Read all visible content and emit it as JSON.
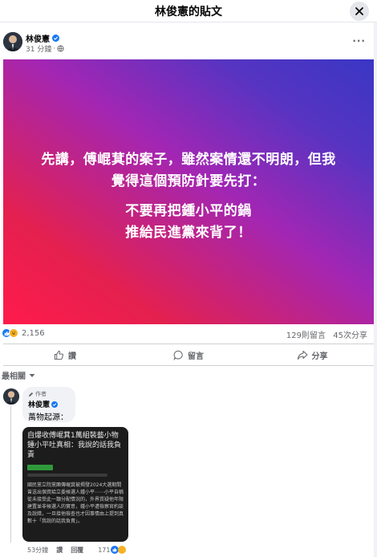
{
  "dialog": {
    "title": "林俊憲的貼文"
  },
  "post": {
    "author": "林俊憲",
    "time": "31 分鐘",
    "image_lines": [
      "先講，傅崐萁的案子，雖然案情還不明朗，但我",
      "覺得這個預防針要先打：",
      "不要再把鍾小平的鍋",
      "推給民進黨來背了！"
    ],
    "image_colors": {
      "start": "#ff1b4b",
      "end": "#3a36c4"
    }
  },
  "stats": {
    "reactions": "2,156",
    "comments": "129則留言",
    "shares": "45次分享"
  },
  "actions": {
    "like": "讚",
    "comment": "留言",
    "share": "分享"
  },
  "sort": {
    "label": "最相關"
  },
  "comment": {
    "badge": "作者",
    "author": "林俊憲",
    "text": "萬物起源：",
    "screenshot": {
      "headline": "自爆收傅崐萁1萬組裝藝小物 鍾小平吐真相：我說的話我負責",
      "body": "國民黨立院黨團傳崐萁被揭發2024大選期間曾送出個資給立委候選人鍾小平⋯⋯小平自稱從未接受此一類分配情況的，外界質疑他年限建置並非候選人的實意，鍾小平遭檢察官約談及說錯，一旦接他檢查也才因事情由上提到真數十「我說的話我負責」。"
    },
    "time": "53分鐘",
    "like": "讚",
    "reply": "回覆",
    "reactions": "171"
  },
  "colors": {
    "brand": "#1877f2",
    "muted": "#65676b"
  }
}
